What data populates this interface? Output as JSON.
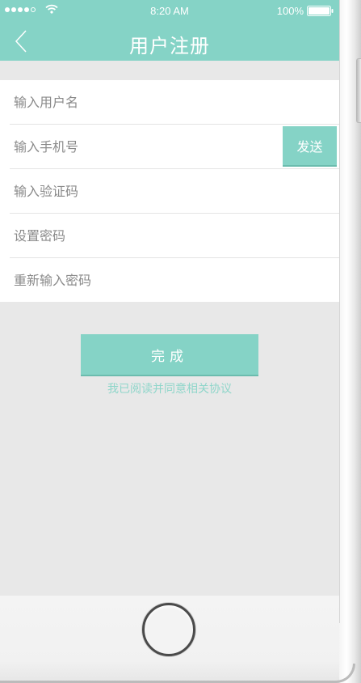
{
  "status_bar": {
    "time": "8:20 AM",
    "battery": "100%",
    "signal_dots": 5,
    "signal_filled": 4,
    "icons": [
      "wifi-icon",
      "battery-icon"
    ]
  },
  "nav": {
    "title": "用户注册",
    "back_icon": "chevron-left-icon"
  },
  "form": {
    "username_placeholder": "输入用户名",
    "phone_placeholder": "输入手机号",
    "code_placeholder": "输入验证码",
    "password_placeholder": "设置密码",
    "confirm_placeholder": "重新输入密码",
    "send_label": "发送"
  },
  "actions": {
    "submit_label": "完成",
    "agreement_text": "我已阅读并同意相关协议"
  },
  "colors": {
    "accent": "#85d3c6",
    "background": "#e8e8e8",
    "agreement_text": "#8fd6ca"
  }
}
